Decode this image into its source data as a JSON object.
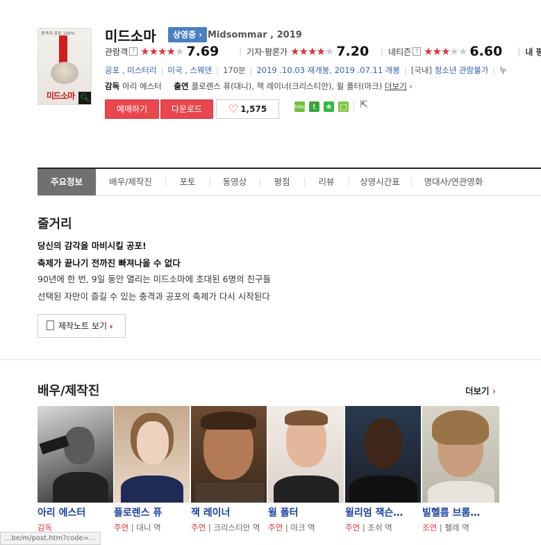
{
  "movie": {
    "title": "미드소마",
    "status_badge": "상영중",
    "original_title_year": "Midsommar , 2019",
    "poster_tagline": "충격과 공포 100%",
    "poster_logo": "미드소마"
  },
  "ratings": [
    {
      "label": "관람객",
      "help": "?",
      "stars_full": "★★★★",
      "stars_empty": "★",
      "score": "7.69"
    },
    {
      "label": "기자·평론가",
      "help": "",
      "stars_full": "★★★★",
      "stars_empty": "★",
      "score": "7.20"
    },
    {
      "label": "네티즌",
      "help": "?",
      "stars_full": "★★★",
      "stars_empty": "★★",
      "score": "6.60"
    },
    {
      "label": "내 평점",
      "help": "",
      "stars_full": "",
      "stars_empty": "",
      "score": ""
    }
  ],
  "info": {
    "genres": "공포 , 미스터리",
    "countries": "미국 , 스웨덴",
    "runtime": "170분",
    "release": "2019 .10.03 재개봉,  2019 .07.11 개봉",
    "grade_prefix": "[국내]",
    "grade": "청소년 관람불가",
    "extra": "누"
  },
  "credits": {
    "director_label": "감독",
    "director": "아리 에스터",
    "cast_label": "출연",
    "cast_text": "플로렌스 퓨(대니), 잭 레이너(크리스티안), 윌 폴터(마크)",
    "more": "더보기"
  },
  "actions": {
    "reserve": "예매하기",
    "download": "다운로드",
    "like_count": "1,575",
    "heart_icon": "♡",
    "share_blog": "blog",
    "share_twitter": "t",
    "share_facebook": "★",
    "share_other": "□",
    "share_export": "⇱"
  },
  "tabs": [
    {
      "label": "주요정보",
      "active": true
    },
    {
      "label": "배우/제작진"
    },
    {
      "label": "포토"
    },
    {
      "label": "동영상"
    },
    {
      "label": "평점"
    },
    {
      "label": "리뷰"
    },
    {
      "label": "상영시간표"
    },
    {
      "label": "명대사/연관영화"
    }
  ],
  "synopsis": {
    "heading": "줄거리",
    "lines": [
      "당신의 감각을 마비시킬 공포!",
      "축제가 끝나기 전까진 빠져나올 수 없다",
      "90년에 한 번, 9일 동안 열리는 미드소마에 초대된 6명의 친구들",
      " 선택된 자만이 즐길 수 있는 충격과 공포의 축제가 다시 시작된다"
    ],
    "note_button": "제작노트 보기",
    "note_caret": "▾"
  },
  "cast_section": {
    "heading": "배우/제작진",
    "more": "더보기",
    "more_arrow": "›",
    "people": [
      {
        "name": "아리 에스터",
        "type": "감독",
        "role": ""
      },
      {
        "name": "플로렌스 퓨",
        "type": "주연",
        "role": "대니 역"
      },
      {
        "name": "잭 레이너",
        "type": "주연",
        "role": "크리스티안 역"
      },
      {
        "name": "윌 폴터",
        "type": "주연",
        "role": "마크 역"
      },
      {
        "name": "윌리엄 잭슨…",
        "type": "주연",
        "role": "조쉬 역"
      },
      {
        "name": "빌헬름 브롬…",
        "type": "조연",
        "role": "펠레 역"
      }
    ]
  },
  "status_bar": {
    "url": "...be/m/post.htm?code=..."
  }
}
